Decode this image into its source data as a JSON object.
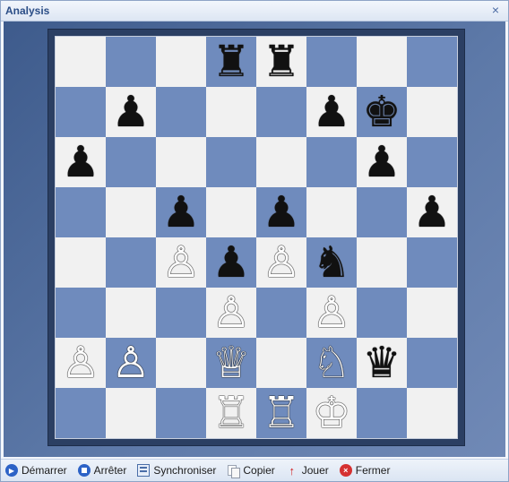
{
  "window": {
    "title": "Analysis",
    "close_symbol": "×"
  },
  "board": {
    "squares": [
      [
        "",
        "",
        "",
        "♜",
        "♜",
        "",
        "",
        ""
      ],
      [
        "",
        "♟",
        "",
        "",
        "",
        "♟",
        "♚",
        ""
      ],
      [
        "♟",
        "",
        "",
        "",
        "",
        "",
        "♟",
        ""
      ],
      [
        "",
        "",
        "♟",
        "",
        "♟",
        "",
        "",
        "♟"
      ],
      [
        "",
        "",
        "♙",
        "♟",
        "♙",
        "♞",
        "",
        ""
      ],
      [
        "",
        "",
        "",
        "♙",
        "",
        "♙",
        "",
        ""
      ],
      [
        "♙",
        "♙",
        "",
        "♕",
        "",
        "♘",
        "♛",
        ""
      ],
      [
        "",
        "",
        "",
        "♖",
        "♖",
        "♔",
        "",
        ""
      ]
    ]
  },
  "toolbar": {
    "buttons": [
      {
        "label": "Démarrer",
        "icon": "play-circle-icon"
      },
      {
        "label": "Arrêter",
        "icon": "stop-circle-icon"
      },
      {
        "label": "Synchroniser",
        "icon": "sync-board-icon"
      },
      {
        "label": "Copier",
        "icon": "copy-icon"
      },
      {
        "label": "Jouer",
        "icon": "red-arrow-up-icon"
      },
      {
        "label": "Fermer",
        "icon": "red-close-icon"
      }
    ]
  }
}
